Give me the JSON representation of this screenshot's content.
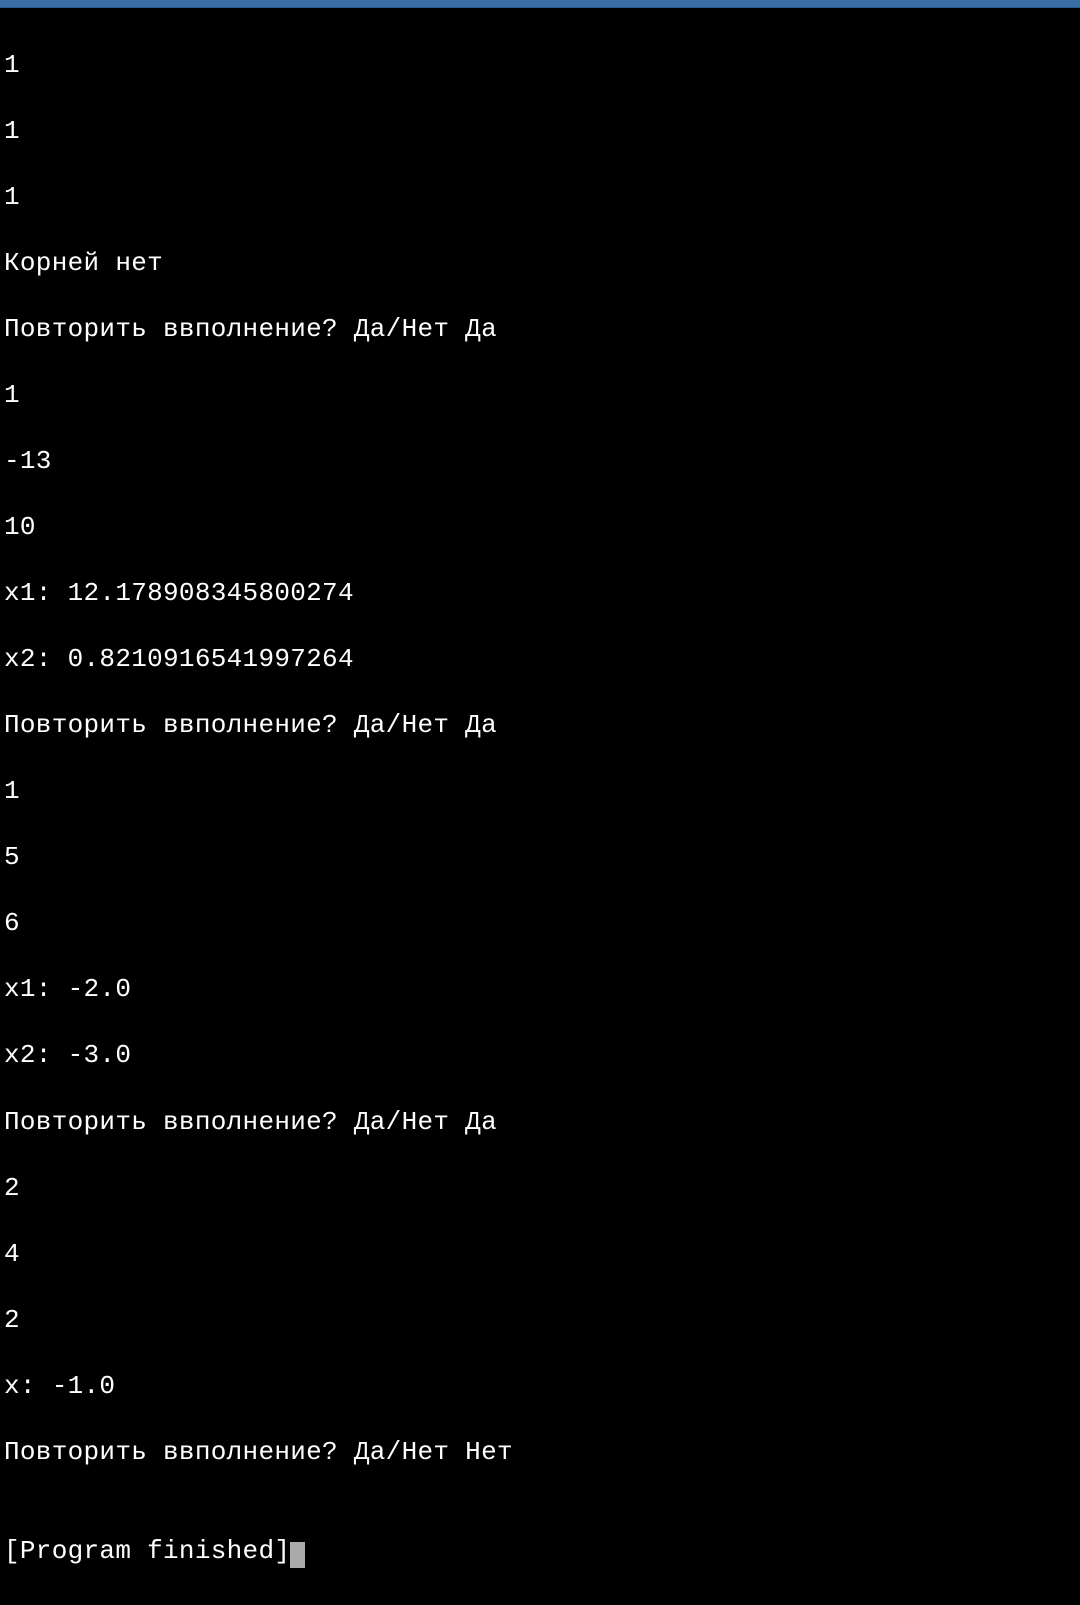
{
  "terminal": {
    "lines": [
      "1",
      "1",
      "1",
      "Корней нет",
      "Повторить ввполнение? Да/Нет Да",
      "1",
      "-13",
      "10",
      "x1: 12.178908345800274",
      "x2: 0.8210916541997264",
      "Повторить ввполнение? Да/Нет Да",
      "1",
      "5",
      "6",
      "x1: -2.0",
      "x2: -3.0",
      "Повторить ввполнение? Да/Нет Да",
      "2",
      "4",
      "2",
      "x: -1.0",
      "Повторить ввполнение? Да/Нет Нет",
      "",
      "[Program finished]"
    ]
  }
}
